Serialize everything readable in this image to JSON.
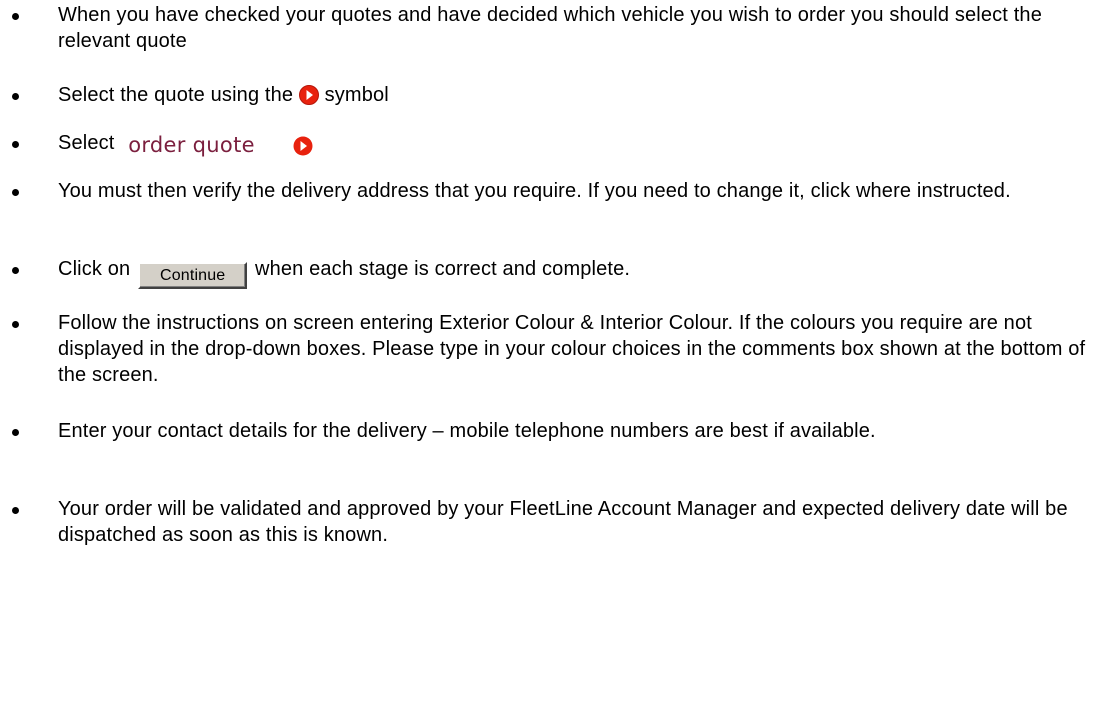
{
  "icons": {
    "arrow": "red-circle-right-arrow-icon",
    "arrow_color": "#e8220e"
  },
  "buttons": {
    "continue_label": "Continue",
    "order_quote_label": "order quote"
  },
  "bullets": [
    {
      "text": "When you have checked your quotes and have decided which vehicle you wish to order you should select the relevant quote"
    },
    {
      "before": "Select the quote using the",
      "after": " symbol"
    },
    {
      "before": "Select "
    },
    {
      "text": "You must then verify the delivery address that you require. If you need to change it, click where instructed."
    },
    {
      "before": "Click on ",
      "after": " when each stage is correct and complete."
    },
    {
      "text": "Follow the instructions on screen entering Exterior Colour & Interior Colour.  If the colours you require are not displayed in the drop-down boxes.  Please type in your colour choices in the comments box shown at the bottom of the screen."
    },
    {
      "text": "Enter your contact details for the delivery – mobile telephone numbers are best if available."
    },
    {
      "text": "Your order will be validated and approved by your FleetLine Account Manager and expected delivery date will be dispatched as soon as this is known."
    }
  ]
}
